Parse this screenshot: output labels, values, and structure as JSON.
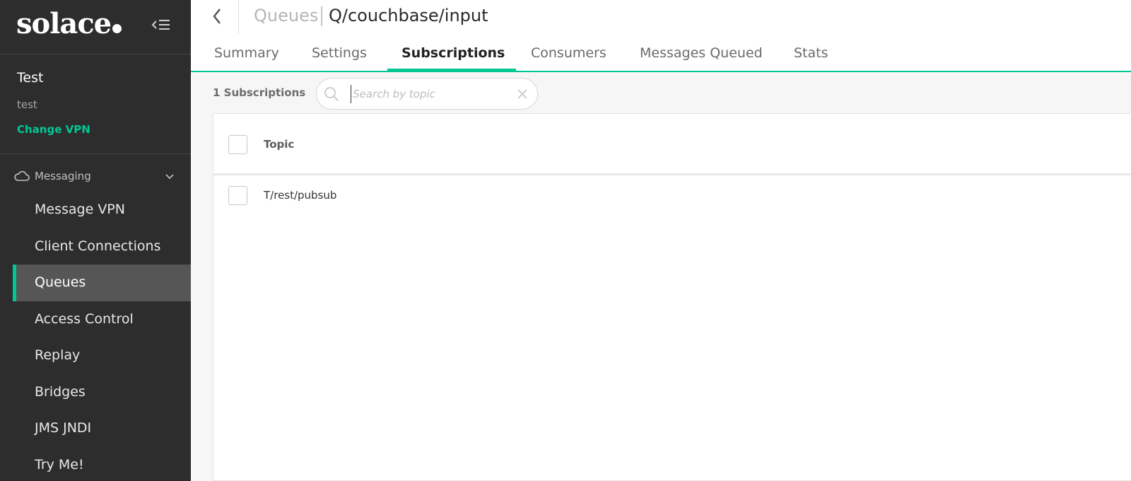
{
  "brand": {
    "logo_text": "solace"
  },
  "vpn": {
    "name": "Test",
    "id": "test",
    "change_label": "Change VPN"
  },
  "sidebar": {
    "section_label": "Messaging",
    "items": [
      {
        "label": "Message VPN",
        "active": false
      },
      {
        "label": "Client Connections",
        "active": false
      },
      {
        "label": "Queues",
        "active": true
      },
      {
        "label": "Access Control",
        "active": false
      },
      {
        "label": "Replay",
        "active": false
      },
      {
        "label": "Bridges",
        "active": false
      },
      {
        "label": "JMS JNDI",
        "active": false
      },
      {
        "label": "Try Me!",
        "active": false
      }
    ]
  },
  "breadcrumb": {
    "parent": "Queues",
    "current": "Q/couchbase/input"
  },
  "tabs": [
    {
      "label": "Summary",
      "active": false
    },
    {
      "label": "Settings",
      "active": false
    },
    {
      "label": "Subscriptions",
      "active": true
    },
    {
      "label": "Consumers",
      "active": false
    },
    {
      "label": "Messages Queued",
      "active": false
    },
    {
      "label": "Stats",
      "active": false
    }
  ],
  "toolbar": {
    "count_label": "1 Subscriptions",
    "search": {
      "placeholder": "Search by topic",
      "value": ""
    }
  },
  "table": {
    "columns": [
      "Topic"
    ],
    "rows": [
      {
        "topic": "T/rest/pubsub"
      }
    ]
  },
  "colors": {
    "accent": "#00c895",
    "sidebar_bg": "#2d2d2d",
    "active_item_bg": "#565656"
  }
}
